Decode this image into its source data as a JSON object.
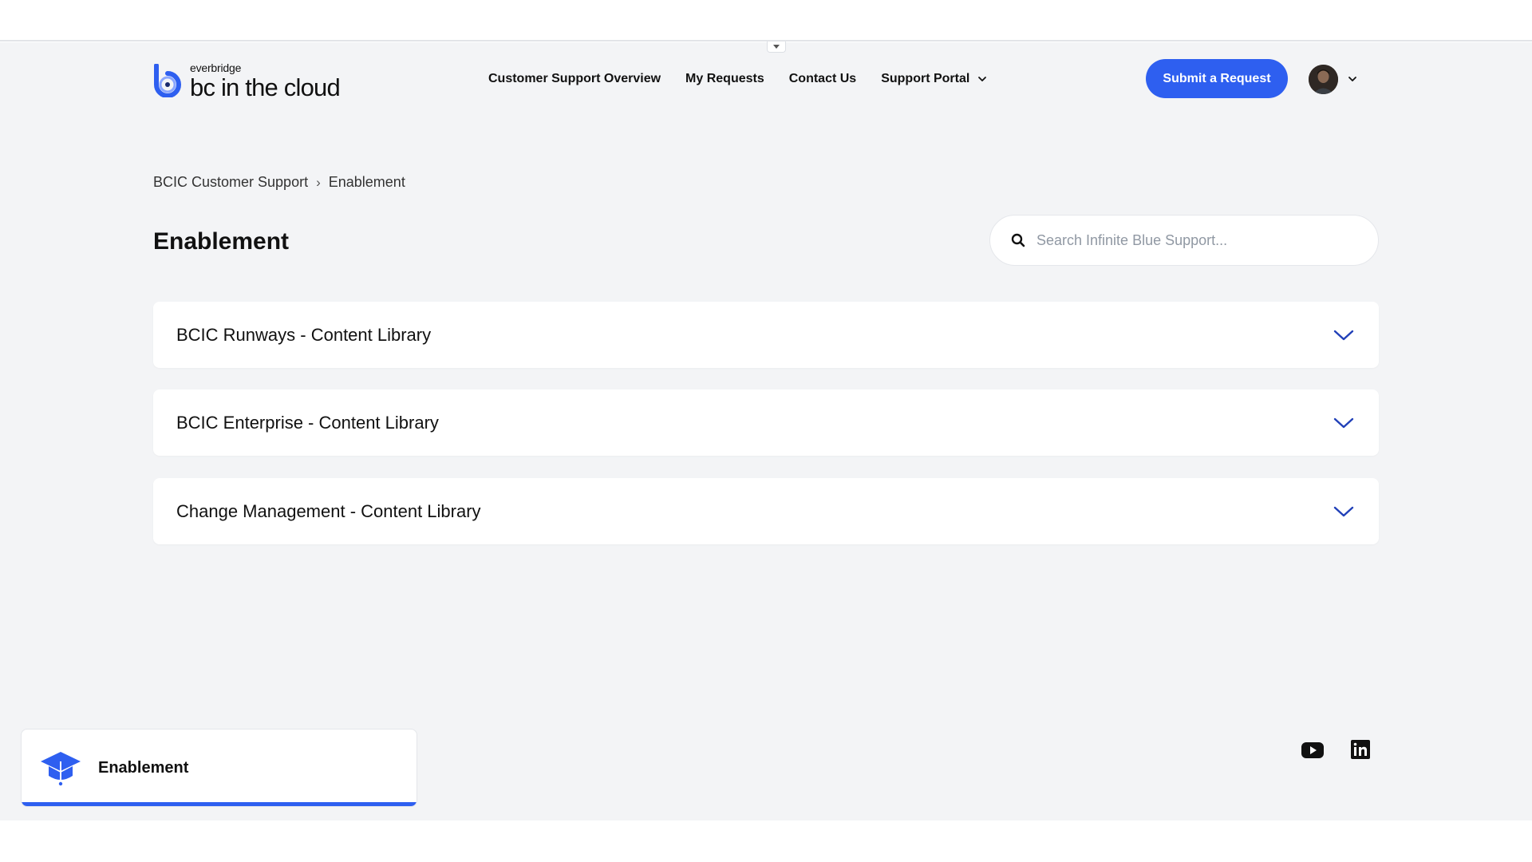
{
  "brand": {
    "small_text": "everbridge",
    "main_text": "bc in the cloud",
    "accent_color": "#2e5ff0"
  },
  "nav": {
    "items": [
      {
        "label": "Customer Support Overview"
      },
      {
        "label": "My Requests"
      },
      {
        "label": "Contact Us"
      },
      {
        "label": "Support Portal",
        "has_dropdown": true
      }
    ]
  },
  "header": {
    "submit_label": "Submit a Request",
    "user_icon": "avatar"
  },
  "breadcrumb": {
    "items": [
      "BCIC Customer Support",
      "Enablement"
    ],
    "separator": "›"
  },
  "page": {
    "title": "Enablement"
  },
  "search": {
    "placeholder": "Search Infinite Blue Support...",
    "value": ""
  },
  "sections": [
    {
      "title": "BCIC Runways - Content Library",
      "expanded": false
    },
    {
      "title": "BCIC Enterprise - Content Library",
      "expanded": false
    },
    {
      "title": "Change Management - Content Library",
      "expanded": false
    }
  ],
  "footer": {
    "card_label": "Enablement",
    "card_icon": "graduation-cap-icon",
    "social": [
      "youtube-icon",
      "linkedin-icon"
    ]
  }
}
